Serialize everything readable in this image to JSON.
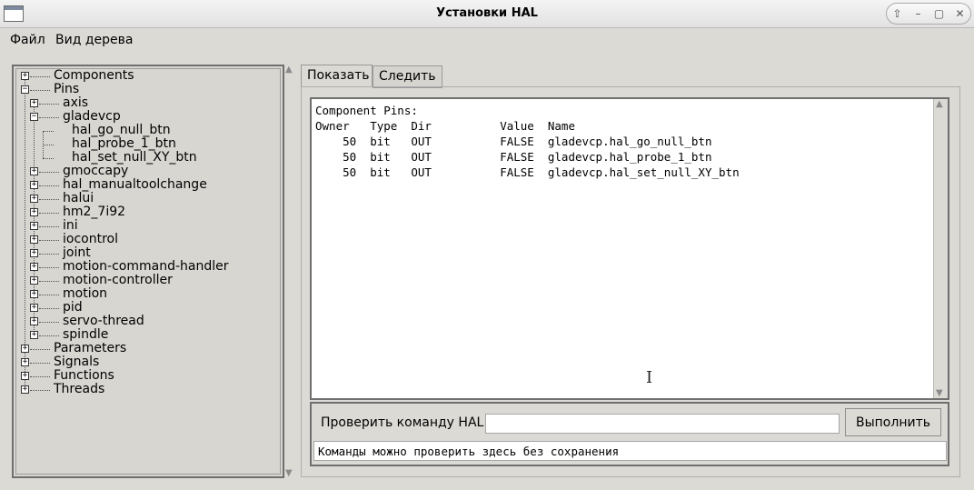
{
  "window": {
    "title": "Установки HAL",
    "controls": [
      "⇧",
      "–",
      "▢",
      "✕"
    ]
  },
  "menu": [
    "Файл",
    "Вид дерева"
  ],
  "tree": {
    "nodes": [
      {
        "label": "Components",
        "level": 0,
        "expanded": false
      },
      {
        "label": "Pins",
        "level": 0,
        "expanded": true
      },
      {
        "label": "axis",
        "level": 1,
        "expanded": false
      },
      {
        "label": "gladevcp",
        "level": 1,
        "expanded": true
      },
      {
        "label": "hal_go_null_btn",
        "level": 2,
        "leaf": true
      },
      {
        "label": "hal_probe_1_btn",
        "level": 2,
        "leaf": true
      },
      {
        "label": "hal_set_null_XY_btn",
        "level": 2,
        "leaf": true
      },
      {
        "label": "gmoccapy",
        "level": 1,
        "expanded": false
      },
      {
        "label": "hal_manualtoolchange",
        "level": 1,
        "expanded": false
      },
      {
        "label": "halui",
        "level": 1,
        "expanded": false
      },
      {
        "label": "hm2_7i92",
        "level": 1,
        "expanded": false
      },
      {
        "label": "ini",
        "level": 1,
        "expanded": false
      },
      {
        "label": "iocontrol",
        "level": 1,
        "expanded": false
      },
      {
        "label": "joint",
        "level": 1,
        "expanded": false
      },
      {
        "label": "motion-command-handler",
        "level": 1,
        "expanded": false
      },
      {
        "label": "motion-controller",
        "level": 1,
        "expanded": false
      },
      {
        "label": "motion",
        "level": 1,
        "expanded": false
      },
      {
        "label": "pid",
        "level": 1,
        "expanded": false
      },
      {
        "label": "servo-thread",
        "level": 1,
        "expanded": false
      },
      {
        "label": "spindle",
        "level": 1,
        "expanded": false
      },
      {
        "label": "Parameters",
        "level": 0,
        "expanded": false
      },
      {
        "label": "Signals",
        "level": 0,
        "expanded": false
      },
      {
        "label": "Functions",
        "level": 0,
        "expanded": false
      },
      {
        "label": "Threads",
        "level": 0,
        "expanded": false
      }
    ]
  },
  "tabs": [
    {
      "label": "Показать",
      "active": true
    },
    {
      "label": "Следить",
      "active": false
    }
  ],
  "output": {
    "heading": "Component Pins:",
    "columns": [
      "Owner",
      "Type",
      "Dir",
      "Value",
      "Name"
    ],
    "rows": [
      [
        "50",
        "bit",
        "OUT",
        "FALSE",
        "gladevcp.hal_go_null_btn"
      ],
      [
        "50",
        "bit",
        "OUT",
        "FALSE",
        "gladevcp.hal_probe_1_btn"
      ],
      [
        "50",
        "bit",
        "OUT",
        "FALSE",
        "gladevcp.hal_set_null_XY_btn"
      ]
    ]
  },
  "command": {
    "label": "Проверить команду HAL:",
    "value": "",
    "button": "Выполнить",
    "status": "Команды можно проверить здесь без сохранения"
  },
  "cursor_glyph": "I"
}
